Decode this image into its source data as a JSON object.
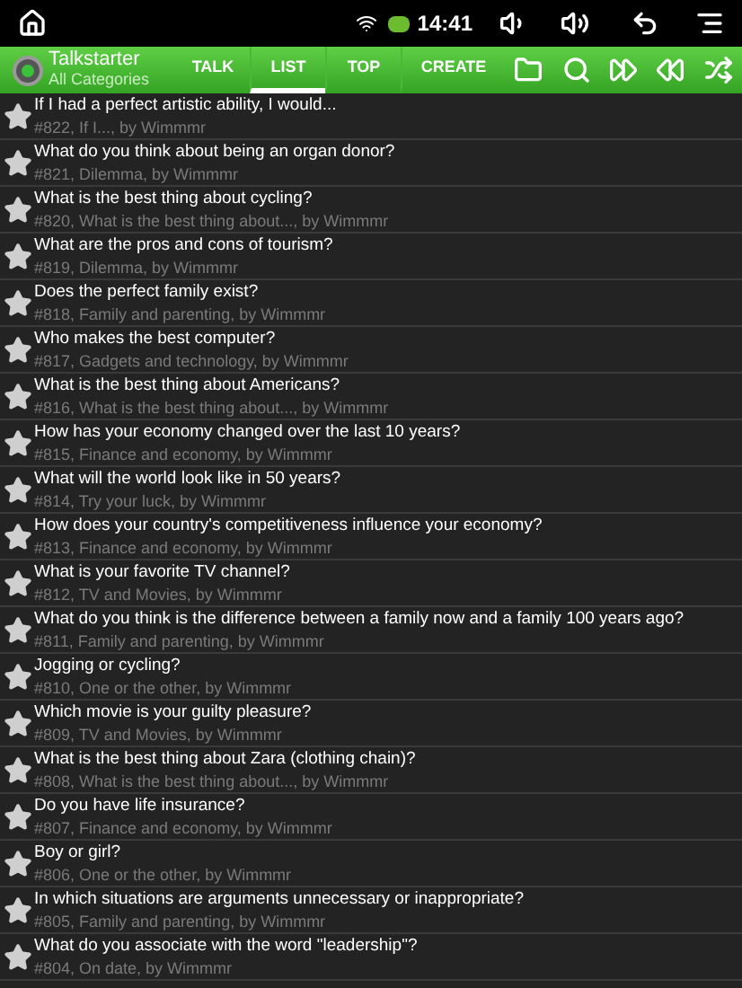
{
  "status_bar": {
    "time": "14:41"
  },
  "action_bar": {
    "title": "Talkstarter",
    "subtitle": "All Categories",
    "tabs": [
      {
        "label": "TALK",
        "selected": false
      },
      {
        "label": "LIST",
        "selected": true
      },
      {
        "label": "TOP",
        "selected": false
      },
      {
        "label": "CREATE",
        "selected": false
      }
    ]
  },
  "items": [
    {
      "title": "If I had a perfect artistic ability, I would...",
      "meta": "#822, If I..., by Wimmmr"
    },
    {
      "title": "What do you think about being an organ donor?",
      "meta": "#821, Dilemma, by Wimmmr"
    },
    {
      "title": "What is the best thing about cycling?",
      "meta": "#820, What is the best thing about..., by Wimmmr"
    },
    {
      "title": "What are the pros and cons of tourism?",
      "meta": "#819, Dilemma, by Wimmmr"
    },
    {
      "title": "Does the perfect family exist?",
      "meta": "#818, Family and parenting, by Wimmmr"
    },
    {
      "title": "Who makes the best computer?",
      "meta": "#817, Gadgets and technology, by Wimmmr"
    },
    {
      "title": "What is the best thing about Americans?",
      "meta": "#816, What is the best thing about..., by Wimmmr"
    },
    {
      "title": "How has your economy changed over the last 10 years?",
      "meta": "#815, Finance and economy, by Wimmmr"
    },
    {
      "title": "What will the world look like in 50 years?",
      "meta": "#814, Try your luck, by Wimmmr"
    },
    {
      "title": "How does your country's competitiveness influence your economy?",
      "meta": "#813, Finance and economy, by Wimmmr"
    },
    {
      "title": "What is your favorite TV channel?",
      "meta": "#812, TV and Movies, by Wimmmr"
    },
    {
      "title": "What do you think is the difference between a family now and a family 100 years ago?",
      "meta": "#811, Family and parenting, by Wimmmr"
    },
    {
      "title": "Jogging or cycling?",
      "meta": "#810, One or the other, by Wimmmr"
    },
    {
      "title": "Which movie is your guilty pleasure?",
      "meta": "#809, TV and Movies, by Wimmmr"
    },
    {
      "title": "What is the best thing about Zara (clothing chain)?",
      "meta": "#808, What is the best thing about..., by Wimmmr"
    },
    {
      "title": "Do you have life insurance?",
      "meta": "#807, Finance and economy, by Wimmmr"
    },
    {
      "title": "Boy or girl?",
      "meta": "#806, One or the other, by Wimmmr"
    },
    {
      "title": "In which situations are arguments unnecessary or inappropriate?",
      "meta": "#805, Family and parenting, by Wimmmr"
    },
    {
      "title": "What do you associate with the word \"leadership\"?",
      "meta": "#804, On date, by Wimmmr"
    }
  ]
}
